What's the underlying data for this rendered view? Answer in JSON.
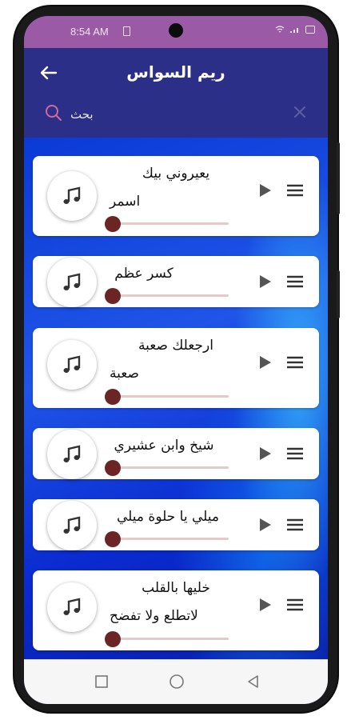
{
  "status": {
    "time": "8:54 AM"
  },
  "appbar": {
    "title": "ريم السواس"
  },
  "search": {
    "placeholder": "بحث"
  },
  "songs": [
    {
      "title": "يعيروني بيك",
      "subtitle": "اسمر"
    },
    {
      "title": "كسر عظم",
      "subtitle": ""
    },
    {
      "title": "ارجعلك صعبة",
      "subtitle": "صعبة"
    },
    {
      "title": "شيخ وابن عشيري",
      "subtitle": ""
    },
    {
      "title": "ميلي يا حلوة ميلي",
      "subtitle": ""
    },
    {
      "title": "خليها بالقلب",
      "subtitle": "لاتطلع ولا تفضح"
    }
  ],
  "colors": {
    "statusbar": "#9a5aa6",
    "appbar": "#2c2f88",
    "seek_thumb": "#6b2525",
    "seek_track": "#e5c9c9",
    "search_icon": "#d06a9a"
  },
  "icons": {
    "back": "arrow-left-icon",
    "search": "search-icon",
    "clear": "close-icon",
    "song": "music-note-icon",
    "play": "play-icon",
    "menu": "hamburger-menu-icon",
    "nav": [
      "recents-square-icon",
      "home-circle-icon",
      "back-triangle-icon"
    ]
  }
}
